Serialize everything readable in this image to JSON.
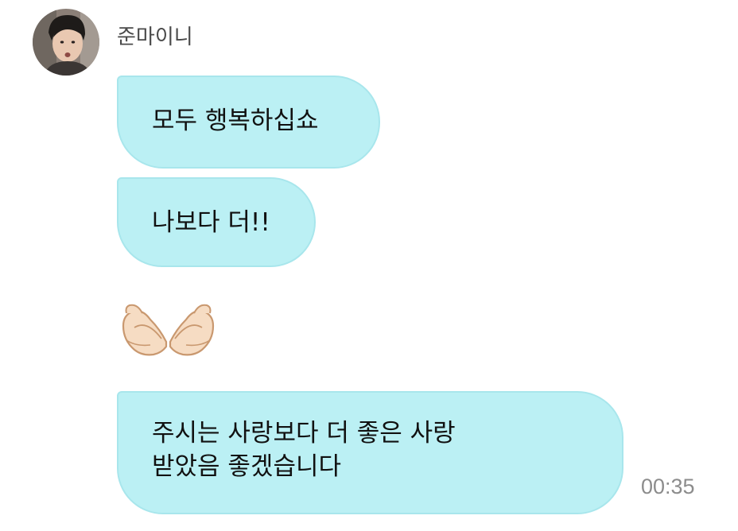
{
  "chat": {
    "sender": {
      "name": "준마이니"
    },
    "messages": [
      {
        "lines": [
          "모두 행복하십쇼"
        ]
      },
      {
        "lines": [
          "나보다 더!!"
        ]
      },
      {
        "emoji": "heart-hands"
      },
      {
        "lines": [
          "주시는 사랑보다 더 좋은 사랑",
          "받았음 좋겠습니다"
        ]
      }
    ],
    "timestamp": "00:35"
  },
  "colors": {
    "bubble_fill": "#bbf0f4",
    "bubble_border": "#a8e6ec",
    "text": "#111111",
    "sender_name": "#4a4a4a",
    "timestamp": "#8c8c8c"
  }
}
